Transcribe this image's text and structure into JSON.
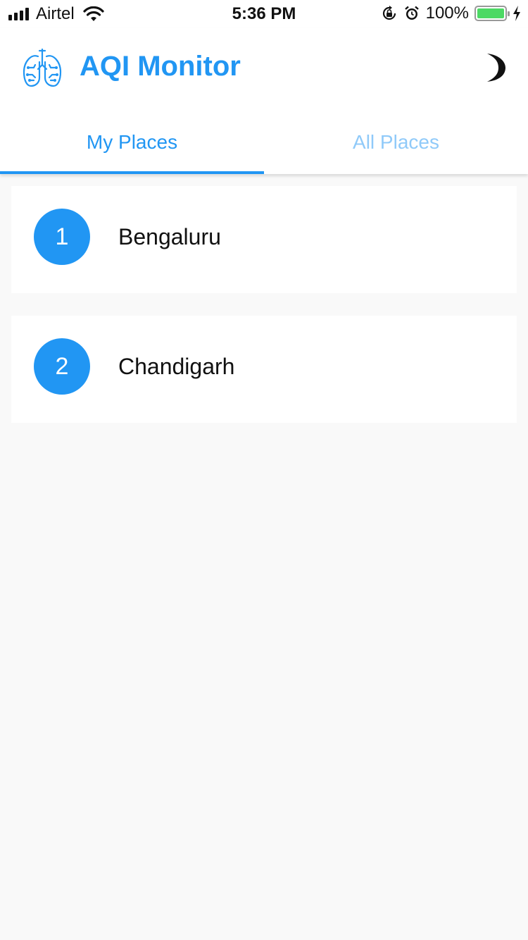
{
  "status_bar": {
    "carrier": "Airtel",
    "time": "5:36 PM",
    "battery_percent": "100%",
    "battery_level": 1.0,
    "icons": [
      "signal-bars-icon",
      "wifi-icon",
      "rotation-lock-icon",
      "alarm-icon",
      "battery-icon",
      "charging-bolt-icon"
    ]
  },
  "app_bar": {
    "title": "AQI Monitor",
    "logo_icon": "lungs-icon",
    "theme_toggle_icon": "moon-icon"
  },
  "tabs": [
    {
      "label": "My Places",
      "active": true
    },
    {
      "label": "All Places",
      "active": false
    }
  ],
  "places": [
    {
      "number": "1",
      "name": "Bengaluru"
    },
    {
      "number": "2",
      "name": "Chandigarh"
    }
  ],
  "colors": {
    "accent": "#2196f3",
    "tab_inactive": "#90caf9",
    "background": "#f9f9f9",
    "battery": "#4cd964"
  }
}
